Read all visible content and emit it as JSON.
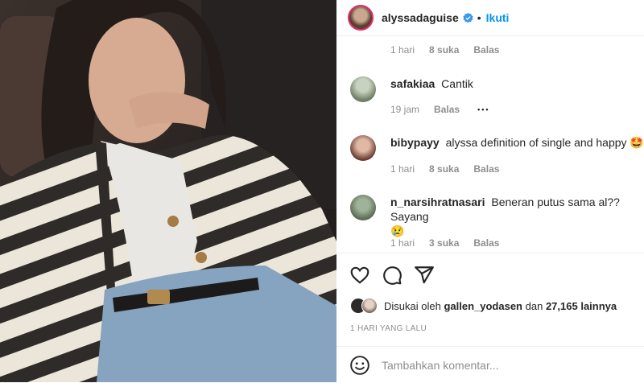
{
  "post": {
    "author": "alyssadaguise",
    "separator": "•",
    "follow_label": "Ikuti"
  },
  "first_comment_meta": {
    "time": "1 hari",
    "likes": "8 suka",
    "reply": "Balas"
  },
  "comments": [
    {
      "user": "safakiaa",
      "text": "Cantik",
      "time": "19 jam",
      "likes": "",
      "reply": "Balas",
      "more": "•••"
    },
    {
      "user": "bibypayy",
      "text": "alyssa definition of single and happy",
      "emoji": "🤩❤️",
      "time": "1 hari",
      "likes": "8 suka",
      "reply": "Balas"
    },
    {
      "user": "n_narsihratnasari",
      "text": "Beneran putus sama al?? Sayang",
      "emoji": "😢",
      "time": "1 hari",
      "likes": "3 suka",
      "reply": "Balas"
    }
  ],
  "likes_line": {
    "prefix": "Disukai oleh",
    "user": "gallen_yodasen",
    "middle": "dan",
    "count": "27,165",
    "suffix": "lainnya"
  },
  "post_date": "1 HARI YANG LALU",
  "add_comment": {
    "placeholder": "Tambahkan komentar..."
  },
  "colors": {
    "link": "#0095f6",
    "muted": "#8e8e8e",
    "text": "#262626",
    "verified": "#3897f0"
  },
  "icons": [
    "verified-badge-icon",
    "heart-icon",
    "comment-icon",
    "share-icon",
    "emoji-icon"
  ]
}
